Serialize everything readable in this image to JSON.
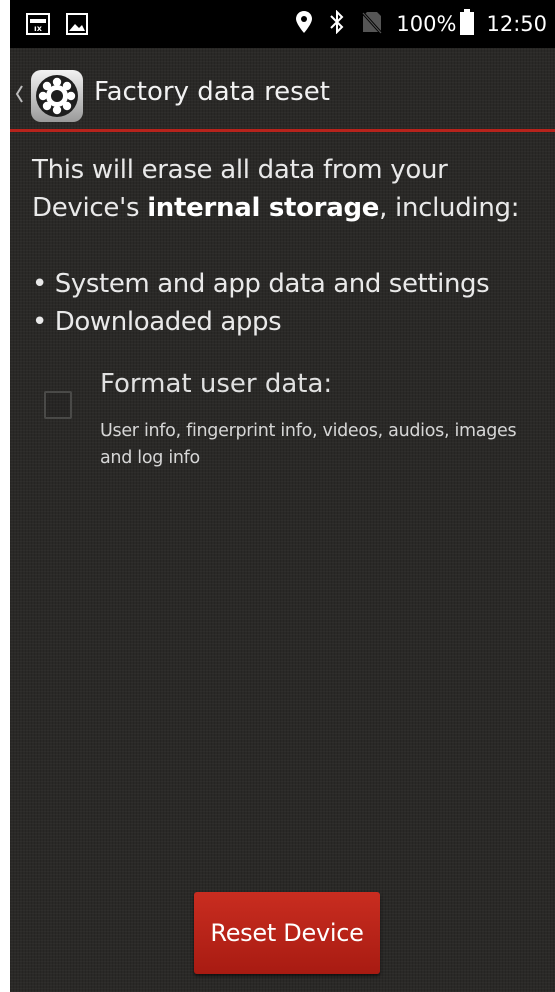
{
  "status_bar": {
    "icons_left": [
      "id-card-icon",
      "image-icon"
    ],
    "icons_right": [
      "location-pin-icon",
      "bluetooth-icon",
      "no-sim-icon",
      "battery-icon"
    ],
    "battery_text": "100%",
    "time": "12:50"
  },
  "action_bar": {
    "back_icon": "chevron-left-icon",
    "app_icon": "settings-gear-icon",
    "title": "Factory data reset",
    "divider_color": "#b7231c"
  },
  "content": {
    "intro_prefix": "This will erase all data from your Device's ",
    "intro_bold": "internal storage",
    "intro_suffix": ", including:",
    "bullets": [
      "• System and app data and settings",
      "• Downloaded apps"
    ],
    "format_option": {
      "label": "Format user data:",
      "description": "User info, fingerprint info, videos, audios, images and log info",
      "checked": false
    }
  },
  "reset_button": {
    "label": "Reset Device",
    "color": "#b8241a"
  }
}
